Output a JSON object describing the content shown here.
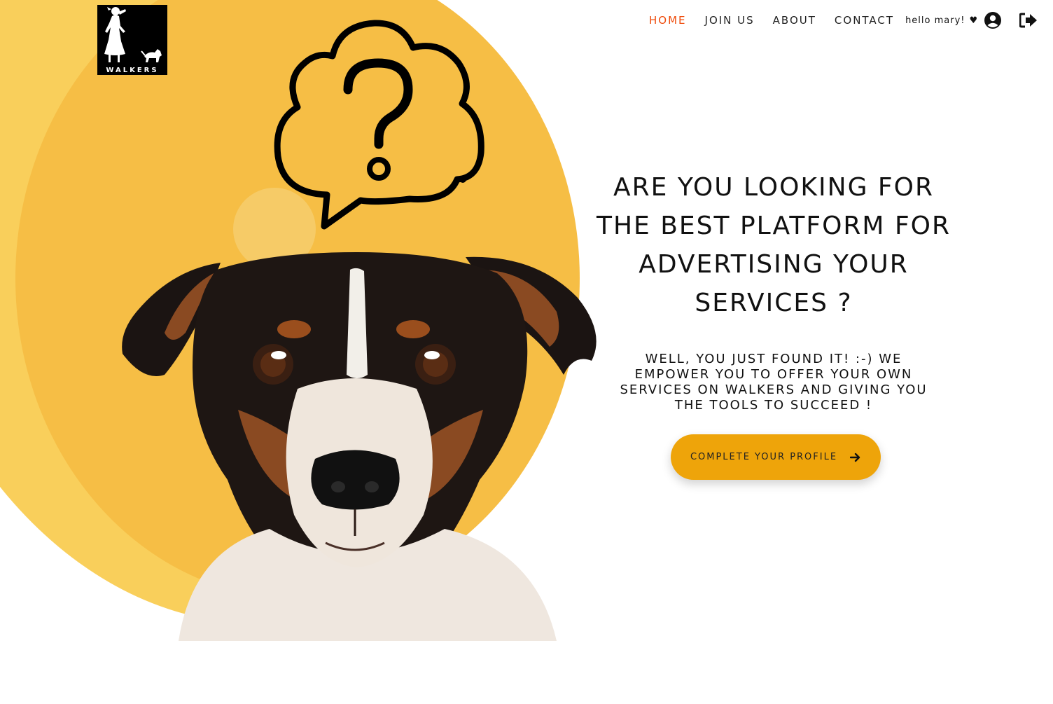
{
  "brand": {
    "logo_text": "WALKERS"
  },
  "nav": {
    "items": [
      {
        "label": "HOME",
        "active": true
      },
      {
        "label": "JOIN US",
        "active": false
      },
      {
        "label": "ABOUT",
        "active": false
      },
      {
        "label": "CONTACT",
        "active": false
      }
    ],
    "greeting": "hello mary!",
    "heart": "♥",
    "user_icon": "user-circle-icon",
    "logout_icon": "sign-out-icon"
  },
  "hero": {
    "headline": "ARE YOU LOOKING FOR THE BEST PLATFORM FOR ADVERTISING YOUR SERVICES ?",
    "subtext": "WELL, YOU JUST FOUND IT! :-) WE EMPOWER YOU TO OFFER YOUR OWN SERVICES ON WALKERS AND GIVING YOU THE TOOLS TO SUCCEED !",
    "cta_label": "COMPLETE YOUR PROFILE",
    "cta_icon": "arrow-right-icon"
  },
  "illustration": {
    "bubble_icon": "question-thought-bubble-icon",
    "photo": "dog-photo"
  },
  "colors": {
    "accent": "#eea40a",
    "active_nav": "#ef4b0b",
    "blob_outer": "#f9cf5b",
    "blob_inner": "#f6be45"
  }
}
